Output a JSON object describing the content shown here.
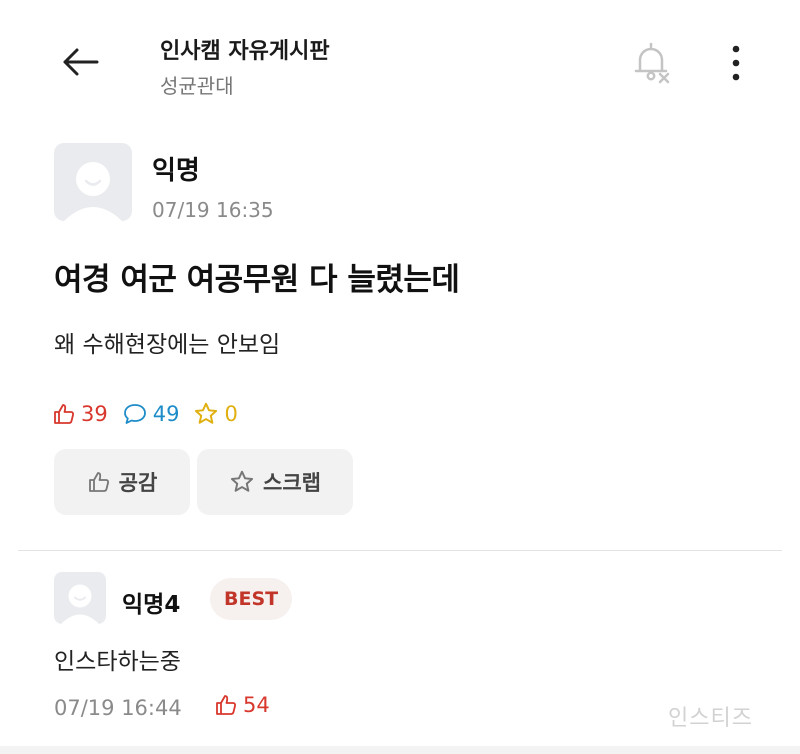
{
  "header": {
    "title": "인사캠 자유게시판",
    "subtitle": "성균관대",
    "icons": {
      "back": "arrow-left-icon",
      "notification": "bell-off-icon",
      "more": "more-vertical-icon"
    }
  },
  "post": {
    "author": "익명",
    "time": "07/19 16:35",
    "title": "여경 여군 여공무원 다 늘렸는데",
    "body": "왜 수해현장에는 안보임",
    "stats": {
      "likes": "39",
      "comments": "49",
      "scraps": "0"
    },
    "actions": {
      "like_label": "공감",
      "scrap_label": "스크랩"
    }
  },
  "comments": [
    {
      "author": "익명4",
      "badge": "BEST",
      "body": "인스타하는중",
      "time": "07/19 16:44",
      "likes": "54"
    }
  ],
  "watermark": "인스티즈",
  "colors": {
    "like": "#d8372d",
    "comment": "#1e8cc8",
    "scrap": "#e0b010",
    "badge": "#c2362a"
  }
}
